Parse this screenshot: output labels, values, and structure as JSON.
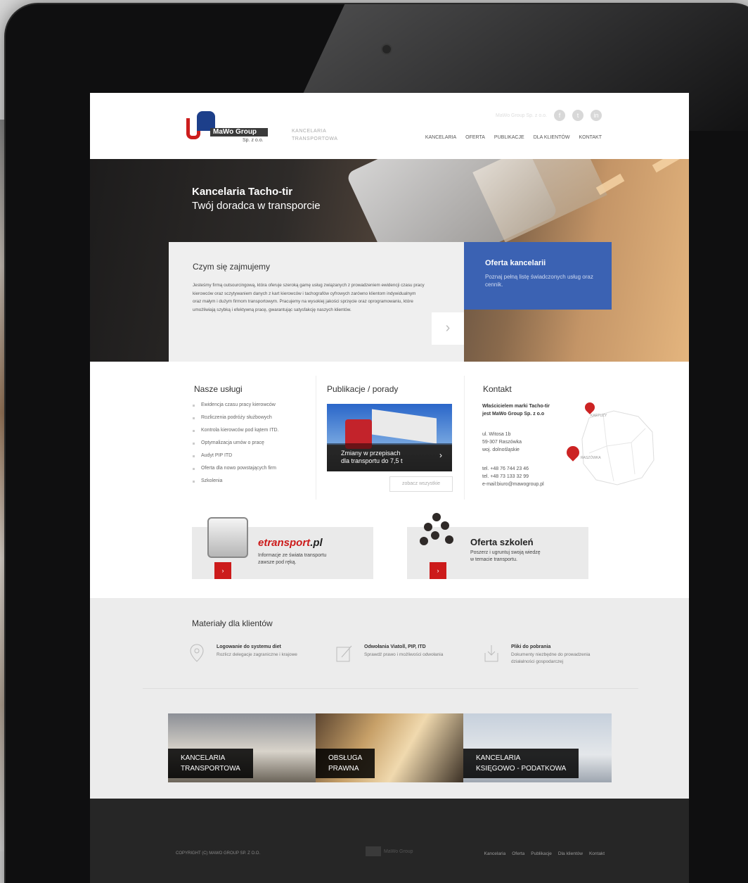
{
  "header": {
    "logo_text": "MaWo Group",
    "logo_sub": "Sp. z o.o.",
    "tagline_line1": "KANCELARIA",
    "tagline_line2": "TRANSPORTOWA",
    "company_name": "MaWo Group Sp. z o.o.",
    "social": [
      "f",
      "t",
      "in"
    ],
    "nav": [
      "KANCELARIA",
      "OFERTA",
      "PUBLIKACJE",
      "DLA KLIENTÓW",
      "KONTAKT"
    ]
  },
  "hero": {
    "title": "Kancelaria Tacho-tir",
    "subtitle": "Twój doradca w transporcie",
    "about_title": "Czym się zajmujemy",
    "about_text": "Jesteśmy firmą outsourcingową, która oferuje szeroką gamę usług związanych z prowadzeniem ewidencji czasu pracy kierowców oraz sczytywaniem danych z kart kierowców i tachografów cyfrowych zarówno klientom indywidualnym oraz małym i dużym firmom transportowym. Pracujemy na wysokiej jakości sprzęcie oraz oprogramowaniu, które umożliwiają szybką i efektywną pracę, gwarantując satysfakcję naszych klientów.",
    "offer_title": "Oferta kancelarii",
    "offer_text": "Poznaj pełną listę świadczonych usług oraz cennik."
  },
  "services": {
    "title": "Nasze usługi",
    "items": [
      "Ewidencja czasu pracy kierowców",
      "Rozliczenia podróży służbowych",
      "Kontrola kierowców pod kątem ITD.",
      "Optymalizacja umów o pracę",
      "Audyt PIP ITD",
      "Oferta dla nowo powstających firm",
      "Szkolenia"
    ]
  },
  "publications": {
    "title": "Publikacje / porady",
    "caption_line1": "Zmiany w przepisach",
    "caption_line2": "dla transportu do 7,5 t",
    "see_all": "zobacz wszystkie"
  },
  "contact": {
    "title": "Kontakt",
    "owner_line1": "Właścicielem marki Tacho-tir",
    "owner_line2": "jest MaWo Group Sp. z o.o",
    "addr_line1": "ul. Witosa 1b",
    "addr_line2": "59-307 Raszówka",
    "addr_line3": "woj. dolnośląskie",
    "tel1": "tel. +48 76 744 23 46",
    "tel2": "tel. +48 73 133 32 99",
    "email": "e-mail:biuro@mawogroup.pl",
    "map_label1": "KARTUZY",
    "map_label2": "RASZÓWKA"
  },
  "promos": {
    "etransport_brand_1": "etransport",
    "etransport_brand_2": ".pl",
    "etransport_line1": "Informacje ze świata transportu",
    "etransport_line2": "zawsze pod ręką.",
    "training_title": "Oferta szkoleń",
    "training_line1": "Poszerz i ugruntuj swoją wiedzę",
    "training_line2": "w temacie transportu.",
    "arrow": "›"
  },
  "materials": {
    "title": "Materiały dla klientów",
    "items": [
      {
        "title": "Logowanie do systemu diet",
        "desc": "Rozlicz delegacje zagraniczne i krajowe",
        "desc2": ""
      },
      {
        "title": "Odwołania Viatoll, PIP, ITD",
        "desc": "Sprawdź prawo i możliwości odwołania",
        "desc2": ""
      },
      {
        "title": "Pliki do pobrania",
        "desc": "Dokumenty niezbędne do prowadzenia",
        "desc2": "działalności gospodarczej"
      }
    ]
  },
  "tiles": [
    {
      "line1": "KANCELARIA",
      "line2": "TRANSPORTOWA"
    },
    {
      "line1": "OBSŁUGA",
      "line2": "PRAWNA"
    },
    {
      "line1": "KANCELARIA",
      "line2": "KSIĘGOWO - PODATKOWA"
    }
  ],
  "footer": {
    "copyright": "COPYRIGHT (C) MAWO GROUP SP. Z O.O.",
    "logo_text": "MaWo Group",
    "nav": [
      "Kancelaria",
      "Oferta",
      "Publikacje",
      "Dla klientów",
      "Kontakt"
    ]
  },
  "colors": {
    "brand_red": "#cc1b1b",
    "brand_blue": "#3b62b3",
    "footer_bg": "#262626"
  }
}
